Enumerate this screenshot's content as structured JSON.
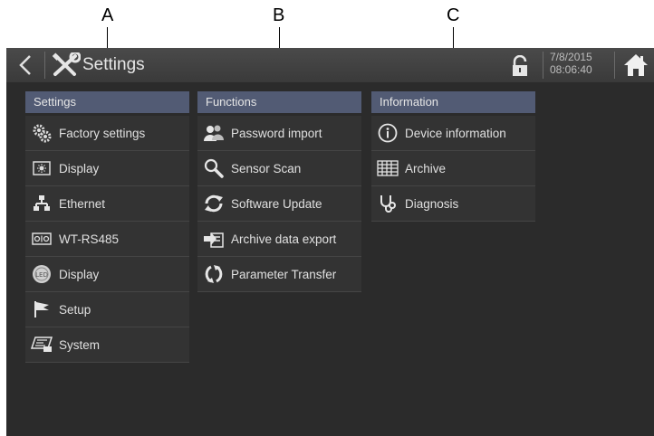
{
  "callouts": {
    "a": "A",
    "b": "B",
    "c": "C"
  },
  "titlebar": {
    "title": "Settings",
    "date": "7/8/2015",
    "time": "08:06:40"
  },
  "columns": [
    {
      "header": "Settings",
      "items": [
        {
          "label": "Factory settings",
          "icon": "gears-icon"
        },
        {
          "label": "Display",
          "icon": "display-icon"
        },
        {
          "label": "Ethernet",
          "icon": "network-icon"
        },
        {
          "label": "WT-RS485",
          "icon": "rs485-port-icon"
        },
        {
          "label": "Display",
          "icon": "led-icon"
        },
        {
          "label": "Setup",
          "icon": "flag-icon"
        },
        {
          "label": "System",
          "icon": "system-icon"
        }
      ]
    },
    {
      "header": "Functions",
      "items": [
        {
          "label": "Password import",
          "icon": "users-icon"
        },
        {
          "label": "Sensor Scan",
          "icon": "magnifier-icon"
        },
        {
          "label": "Software Update",
          "icon": "refresh-icon"
        },
        {
          "label": "Archive data export",
          "icon": "export-icon"
        },
        {
          "label": "Parameter Transfer",
          "icon": "transfer-icon"
        }
      ]
    },
    {
      "header": "Information",
      "items": [
        {
          "label": "Device information",
          "icon": "info-icon"
        },
        {
          "label": "Archive",
          "icon": "archive-icon"
        },
        {
          "label": "Diagnosis",
          "icon": "stethoscope-icon"
        }
      ]
    }
  ]
}
